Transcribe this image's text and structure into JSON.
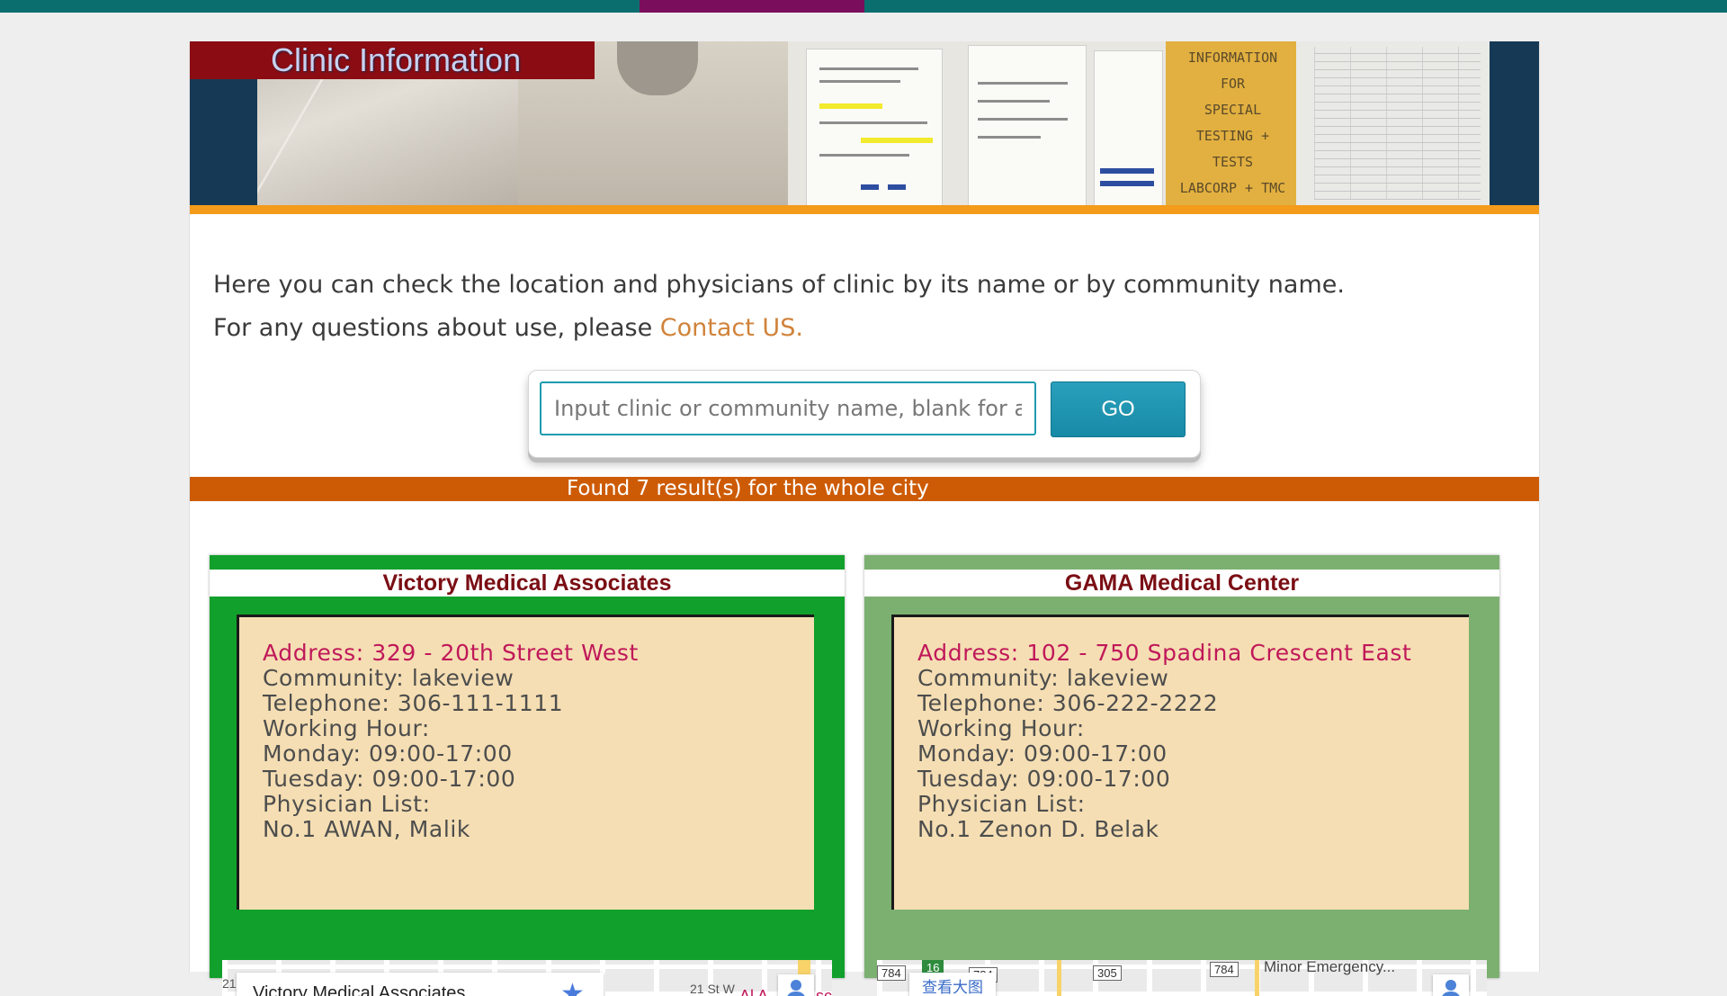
{
  "banner": {
    "title": "Clinic Information",
    "note_lines": [
      "INFORMATION FOR",
      "SPECIAL",
      "TESTING +",
      "TESTS",
      "LABCORP + TMC"
    ]
  },
  "intro": {
    "line1": "Here you can check the location and physicians of clinic by its name or by community name.",
    "line2_prefix": "For any questions about use, please ",
    "contact_link": "Contact US."
  },
  "search": {
    "placeholder": "Input clinic or community name, blank for all",
    "value": "",
    "go_label": "GO"
  },
  "results": {
    "summary": "Found 7 result(s) for the whole city"
  },
  "clinics": [
    {
      "name": "Victory Medical Associates",
      "address": "Address: 329 - 20th Street West",
      "community": "Community: lakeview",
      "telephone": "Telephone: 306-111-1111",
      "working_hour_label": "Working Hour:",
      "hours": [
        "Monday: 09:00-17:00",
        "Tuesday: 09:00-17:00"
      ],
      "physician_label": "Physician List:",
      "physicians": [
        "No.1 AWAN, Malik"
      ],
      "map": {
        "place_name": "Victory Medical Associates",
        "labels": [
          "21 St W",
          "Al A",
          "sc",
          "21"
        ]
      }
    },
    {
      "name": "GAMA Medical Center",
      "address": "Address: 102 - 750 Spadina Crescent East",
      "community": "Community: lakeview",
      "telephone": "Telephone: 306-222-2222",
      "working_hour_label": "Working Hour:",
      "hours": [
        "Monday: 09:00-17:00",
        "Tuesday: 09:00-17:00"
      ],
      "physician_label": "Physician List:",
      "physicians": [
        "No.1 Zenon D. Belak"
      ],
      "map": {
        "big_map_button": "查看大图",
        "labels": [
          "Minor Emergency...",
          "784",
          "305",
          "784",
          "16",
          "784"
        ]
      }
    }
  ],
  "colors": {
    "top_bar": "#0b6e6e",
    "top_bar_accent": "#7a0d5c",
    "banner_title_bg": "#8b0c12",
    "banner_underline": "#f49b1c",
    "result_bar": "#cd5b05",
    "card1_bg": "#12a02c",
    "card2_bg": "#7bb070",
    "card_info_bg": "#f5deb3",
    "address_text": "#c0185a",
    "contact_link": "#d0833a",
    "go_button": "#178aa6"
  }
}
